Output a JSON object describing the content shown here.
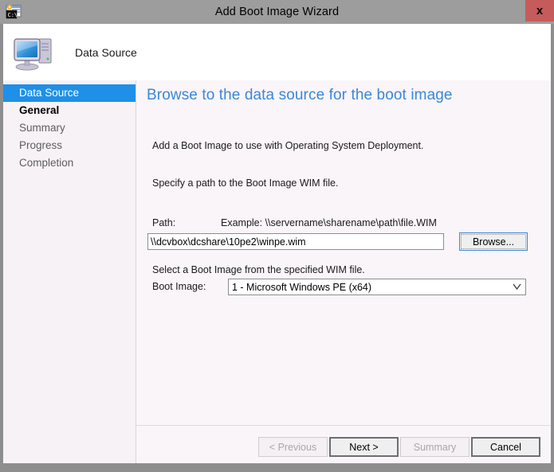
{
  "titlebar": {
    "title": "Add Boot Image Wizard",
    "app_icon": "console-app-icon",
    "close_label": "x",
    "close_icon": "close-icon",
    "close_color": "#c55b5b",
    "bar_color": "#9d9d9d"
  },
  "header": {
    "icon": "computer-icon",
    "title": "Data Source"
  },
  "sidebar": {
    "items": [
      {
        "label": "Data Source",
        "state": "current"
      },
      {
        "label": "General",
        "state": "visited"
      },
      {
        "label": "Summary",
        "state": "pending"
      },
      {
        "label": "Progress",
        "state": "pending"
      },
      {
        "label": "Completion",
        "state": "pending"
      }
    ],
    "highlight_color": "#1e90e8"
  },
  "content": {
    "heading": "Browse to the data source for the boot image",
    "heading_color": "#3a87d8",
    "paragraph_1": "Add a Boot Image to use with Operating System Deployment.",
    "paragraph_2": "Specify a path to the Boot Image WIM file.",
    "path_label": "Path:",
    "path_example": "Example: \\\\servername\\sharename\\path\\file.WIM",
    "path_value": "\\\\dcvbox\\dcshare\\10pe2\\winpe.wim",
    "path_placeholder": "",
    "browse_label": "Browse...",
    "select_instruction": "Select a Boot Image from the specified WIM file.",
    "boot_image_label": "Boot Image:",
    "boot_image_value": "1 - Microsoft Windows PE (x64)",
    "boot_image_options": [
      "1 - Microsoft Windows PE (x64)"
    ],
    "dropdown_icon": "chevron-down-icon"
  },
  "footer": {
    "buttons": [
      {
        "label": "< Previous",
        "state": "disabled"
      },
      {
        "label": "Next >",
        "state": "focused"
      },
      {
        "label": "Summary",
        "state": "disabled"
      },
      {
        "label": "Cancel",
        "state": "default"
      }
    ]
  }
}
